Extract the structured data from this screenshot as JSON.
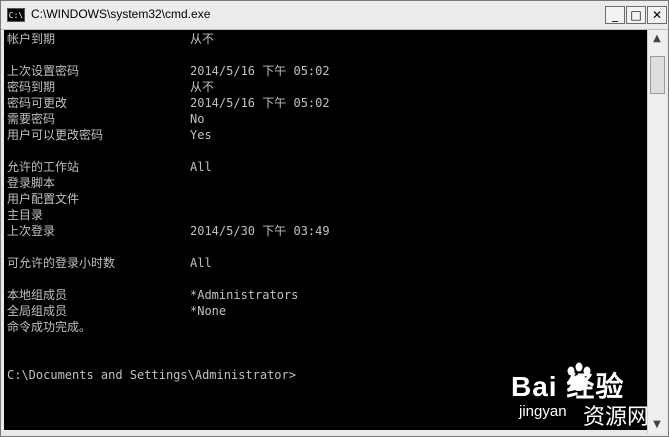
{
  "window": {
    "title": "C:\\WINDOWS\\system32\\cmd.exe",
    "icon_text": "C:\\",
    "controls": {
      "minimize": "_",
      "maximize": "□",
      "close": "✕"
    }
  },
  "console": {
    "lines": [
      {
        "label": "帐户到期",
        "value": "从不"
      },
      {
        "label": "",
        "value": ""
      },
      {
        "label": "上次设置密码",
        "value": "2014/5/16 下午 05:02"
      },
      {
        "label": "密码到期",
        "value": "从不"
      },
      {
        "label": "密码可更改",
        "value": "2014/5/16 下午 05:02"
      },
      {
        "label": "需要密码",
        "value": "No"
      },
      {
        "label": "用户可以更改密码",
        "value": "Yes"
      },
      {
        "label": "",
        "value": ""
      },
      {
        "label": "允许的工作站",
        "value": "All"
      },
      {
        "label": "登录脚本",
        "value": ""
      },
      {
        "label": "用户配置文件",
        "value": ""
      },
      {
        "label": "主目录",
        "value": ""
      },
      {
        "label": "上次登录",
        "value": "2014/5/30 下午 03:49"
      },
      {
        "label": "",
        "value": ""
      },
      {
        "label": "可允许的登录小时数",
        "value": "All"
      },
      {
        "label": "",
        "value": ""
      },
      {
        "label": "本地组成员",
        "value": "*Administrators"
      },
      {
        "label": "全局组成员",
        "value": "*None"
      },
      {
        "label": "命令成功完成。",
        "value": ""
      },
      {
        "label": "",
        "value": ""
      },
      {
        "label": "",
        "value": ""
      },
      {
        "label": "C:\\Documents and Settings\\Administrator>",
        "value": ""
      }
    ]
  },
  "watermark": {
    "logo": "Bai  经验",
    "domain": "jingyan",
    "site": "资源网"
  }
}
